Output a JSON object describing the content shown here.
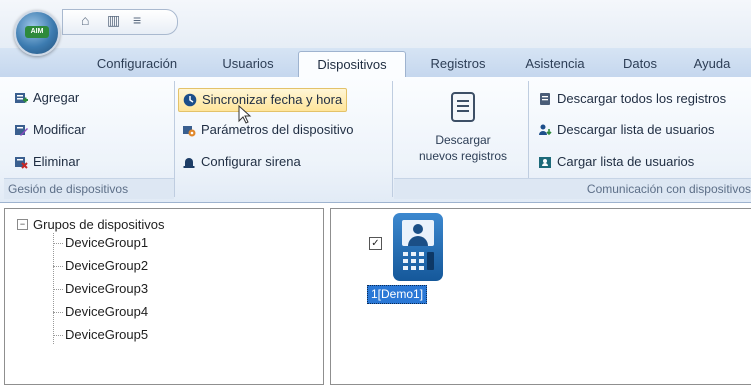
{
  "app": {
    "logo_text": "AIM"
  },
  "tabs": [
    {
      "label": "Configuración"
    },
    {
      "label": "Usuarios"
    },
    {
      "label": "Dispositivos"
    },
    {
      "label": "Registros"
    },
    {
      "label": "Asistencia"
    },
    {
      "label": "Datos"
    },
    {
      "label": "Ayuda"
    }
  ],
  "active_tab": "Dispositivos",
  "ribbon": {
    "device_management": {
      "caption": "Gesión de dispositivos",
      "add": "Agregar",
      "modify": "Modificar",
      "delete": "Eliminar"
    },
    "device_actions": {
      "sync_time": "Sincronizar fecha y hora",
      "device_params": "Parámetros del dispositivo",
      "configure_siren": "Configurar sirena"
    },
    "download_new": {
      "line1": "Descargar",
      "line2": "nuevos registros"
    },
    "communication": {
      "caption": "Comunicación con dispositivos",
      "download_all_logs": "Descargar todos los registros",
      "download_user_list": "Descargar lista de usuarios",
      "upload_user_list": "Cargar lista de usuarios"
    }
  },
  "tree": {
    "root": "Grupos de dispositivos",
    "children": [
      "DeviceGroup1",
      "DeviceGroup2",
      "DeviceGroup3",
      "DeviceGroup4",
      "DeviceGroup5"
    ]
  },
  "device": {
    "label": "1[Demo1]",
    "checked": true
  },
  "colors": {
    "accent": "#2a78d6",
    "ribbon_bg": "#edf3fa",
    "highlight": "#ffe59a"
  }
}
